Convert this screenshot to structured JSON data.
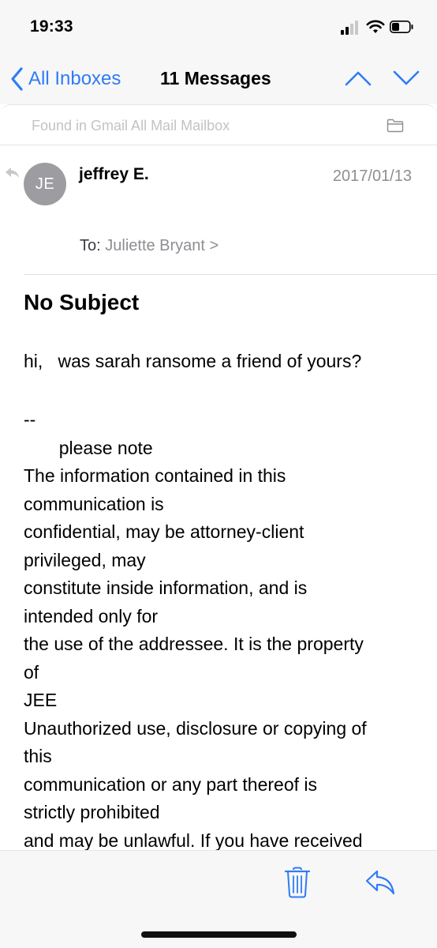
{
  "status_bar": {
    "time": "19:33"
  },
  "nav": {
    "back_label": "All Inboxes",
    "title": "11 Messages"
  },
  "found_banner": {
    "text": "Found in Gmail All Mail Mailbox"
  },
  "message": {
    "avatar_initials": "JE",
    "sender": "jeffrey E.",
    "date": "2017/01/13",
    "to_label": "To:",
    "to_name": "Juliette Bryant >",
    "subject": "No Subject",
    "greeting": "hi,   was sarah ransome a friend of yours?",
    "body": "--\n       please note\nThe information contained in this\ncommunication is\nconfidential, may be attorney-client\nprivileged, may\nconstitute inside information, and is\nintended only for\nthe use of the addressee. It is the property\nof\nJEE\nUnauthorized use, disclosure or copying of\nthis\ncommunication or any part thereof is\nstrictly prohibited\nand may be unlawful. If you have received"
  },
  "colors": {
    "accent": "#2f7cf6",
    "chrome_bg": "#f7f7f7",
    "muted_text": "#8e8e93",
    "avatar_bg": "#9d9da1"
  },
  "icons": {
    "back": "chevron-left-icon",
    "up": "chevron-up-icon",
    "down": "chevron-down-icon",
    "folder": "folder-icon",
    "reply_indicator": "reply-indicator-icon",
    "trash": "trash-icon",
    "reply": "reply-icon"
  }
}
